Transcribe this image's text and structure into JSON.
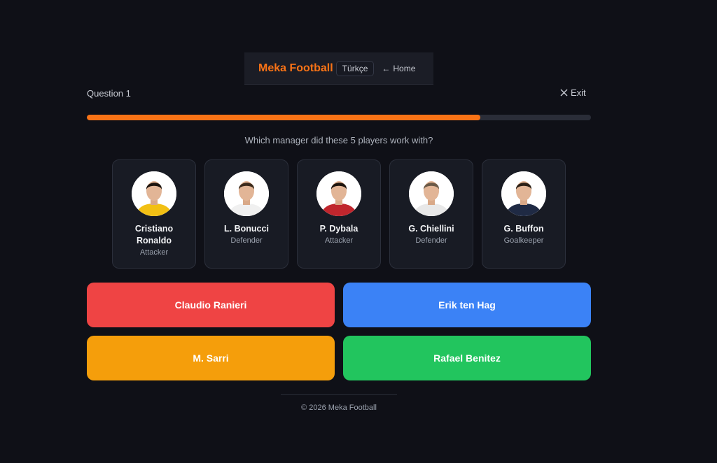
{
  "header": {
    "brand": "Meka Football",
    "language_label": "Türkçe",
    "home_label": "Home"
  },
  "quiz": {
    "question_label": "Question 1",
    "exit_label": "Exit",
    "progress_fraction": 0.78,
    "prompt": "Which manager did these 5 players work with?"
  },
  "players": [
    {
      "name": "Cristiano Ronaldo",
      "position": "Attacker",
      "kit_color": "#f2c014",
      "hair_color": "#1c140e"
    },
    {
      "name": "L. Bonucci",
      "position": "Defender",
      "kit_color": "#f0f0f0",
      "hair_color": "#3b2a1c"
    },
    {
      "name": "P. Dybala",
      "position": "Attacker",
      "kit_color": "#c0262d",
      "hair_color": "#1c140e"
    },
    {
      "name": "G. Chiellini",
      "position": "Defender",
      "kit_color": "#e8e8e8",
      "hair_color": "#6b5a48"
    },
    {
      "name": "G. Buffon",
      "position": "Goalkeeper",
      "kit_color": "#1f2a44",
      "hair_color": "#2b2016"
    }
  ],
  "answers": [
    {
      "label": "Claudio Ranieri",
      "color": "#ef4444"
    },
    {
      "label": "Erik ten Hag",
      "color": "#3b82f6"
    },
    {
      "label": "M. Sarri",
      "color": "#f59e0b"
    },
    {
      "label": "Rafael Benitez",
      "color": "#22c55e"
    }
  ],
  "footer": {
    "text": "© 2026 Meka Football"
  },
  "colors": {
    "accent": "#f97316",
    "background": "#0f1017"
  }
}
